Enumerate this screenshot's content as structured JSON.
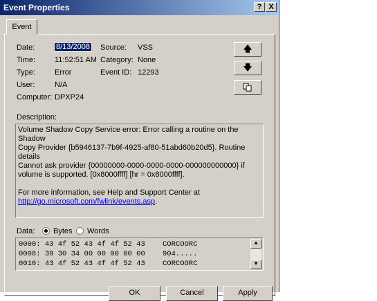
{
  "window": {
    "title": "Event Properties",
    "help_button": "?",
    "close_button": "X"
  },
  "tabs": [
    {
      "label": "Event",
      "selected": true
    }
  ],
  "fields": {
    "date_label": "Date:",
    "date_value": "8/13/2008",
    "time_label": "Time:",
    "time_value": "11:52:51 AM",
    "type_label": "Type:",
    "type_value": "Error",
    "user_label": "User:",
    "user_value": "N/A",
    "computer_label": "Computer:",
    "computer_value": "DPXP24",
    "source_label": "Source:",
    "source_value": "VSS",
    "category_label": "Category:",
    "category_value": "None",
    "event_id_label": "Event ID:",
    "event_id_value": "12293"
  },
  "side_buttons": {
    "up_icon": "arrow-up-icon",
    "down_icon": "arrow-down-icon",
    "copy_icon": "copy-icon"
  },
  "description": {
    "label": "Description:",
    "lines": [
      "Volume Shadow Copy Service error: Error calling a routine on the Shadow",
      "Copy Provider {b5946137-7b9f-4925-af80-51abd60b20d5}. Routine details",
      "Cannot ask provider {00000000-0000-0000-0000-000000000000} if",
      "volume is supported. [0x8000ffff] [hr = 0x8000ffff]."
    ],
    "more_info": "For more information, see Help and Support Center at",
    "link": "http://go.microsoft.com/fwlink/events.asp",
    "link_suffix": "."
  },
  "data_section": {
    "label": "Data:",
    "options": [
      "Bytes",
      "Words"
    ],
    "selected": "Bytes",
    "rows": [
      {
        "offset": "0000:",
        "hex": "43 4f 52 43 4f 4f 52 43",
        "ascii": "CORCOORC"
      },
      {
        "offset": "0008:",
        "hex": "39 30 34 00 00 00 00 00",
        "ascii": "904....."
      },
      {
        "offset": "0010:",
        "hex": "43 4f 52 43 4f 4f 52 43",
        "ascii": "CORCOORC"
      }
    ]
  },
  "bottom_buttons": [
    "OK",
    "Cancel",
    "Apply"
  ]
}
